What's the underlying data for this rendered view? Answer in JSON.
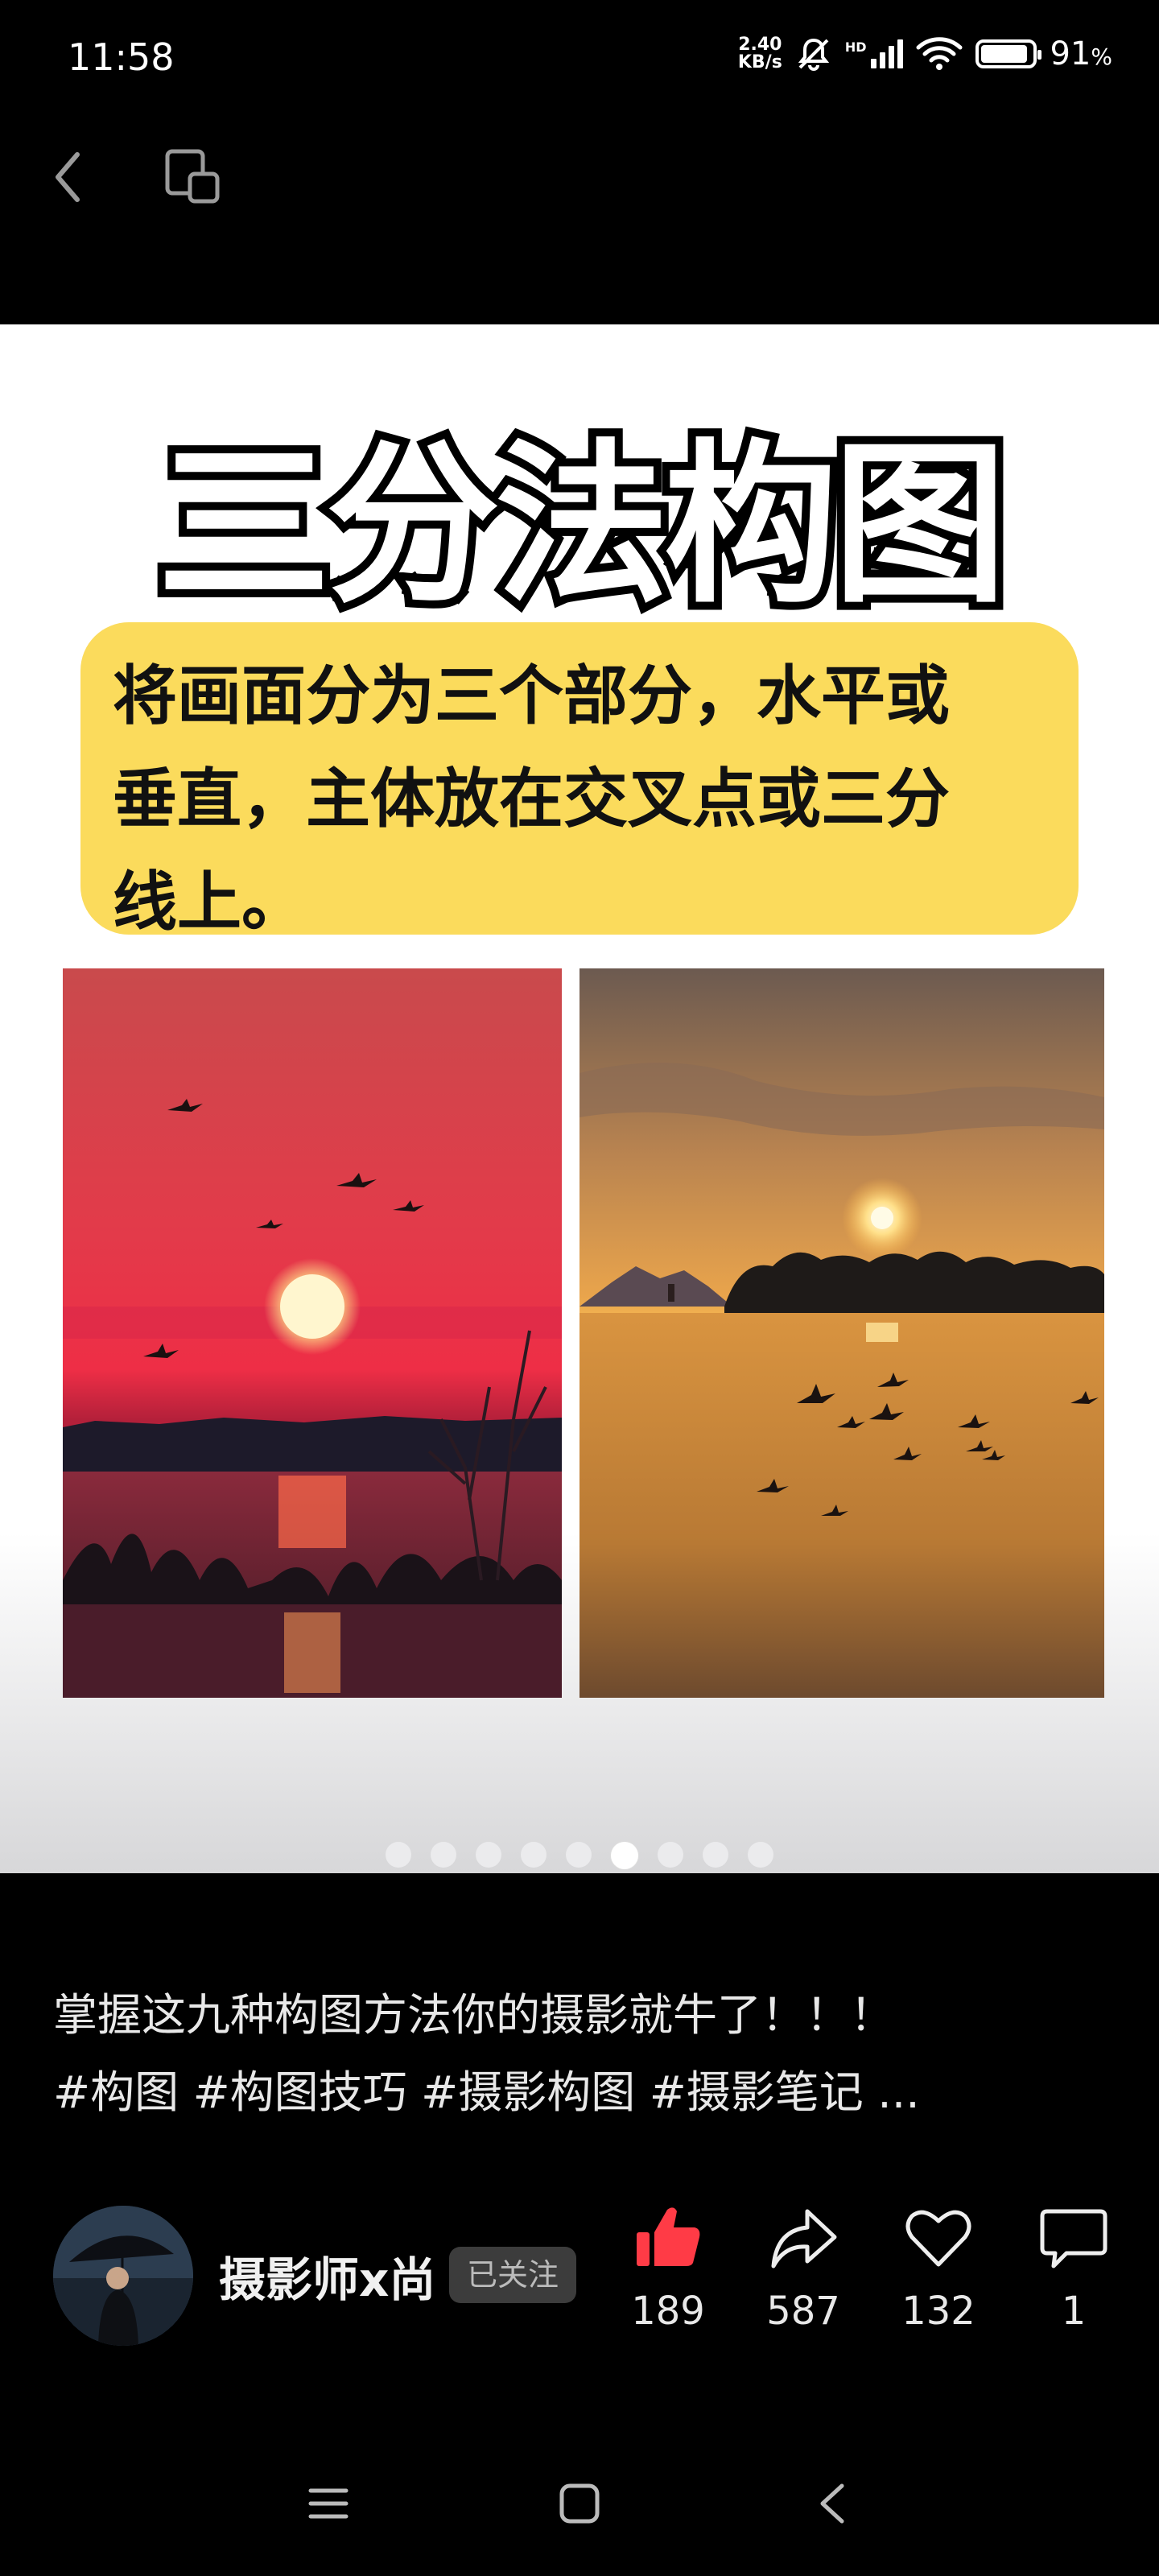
{
  "status_bar": {
    "time": "11:58",
    "net_speed_value": "2.40",
    "net_speed_unit": "KB/s",
    "battery_percent": "91",
    "battery_unit": "%",
    "battery_level": 0.91,
    "icons": [
      "mute-bell-icon",
      "hd-signal-icon",
      "wifi-icon",
      "battery-icon"
    ]
  },
  "top_nav": {
    "icons": [
      "back-chevron-icon",
      "device-switch-icon"
    ]
  },
  "post_image": {
    "title": "三分法构图",
    "description_lines": [
      "将画面分为三个部分，水平或",
      "垂直，主体放在交叉点或三分",
      "线上。"
    ],
    "carousel_total": 9,
    "carousel_active_index": 5,
    "colors": {
      "highlight": "#fbdb5c"
    }
  },
  "caption": {
    "text": "掌握这九种构图方法你的摄影就牛了！！！",
    "tags": "#构图 #构图技巧 #摄影构图 #摄影笔记 ..."
  },
  "author": {
    "name": "摄影师x尚",
    "follow_status": "已关注"
  },
  "actions": {
    "like_count": "189",
    "share_count": "587",
    "favorite_count": "132",
    "comment_count": "1",
    "colors": {
      "like_active": "#ff3b46"
    }
  },
  "android_nav": {
    "icons": [
      "menu-icon",
      "home-icon",
      "back-icon"
    ]
  }
}
